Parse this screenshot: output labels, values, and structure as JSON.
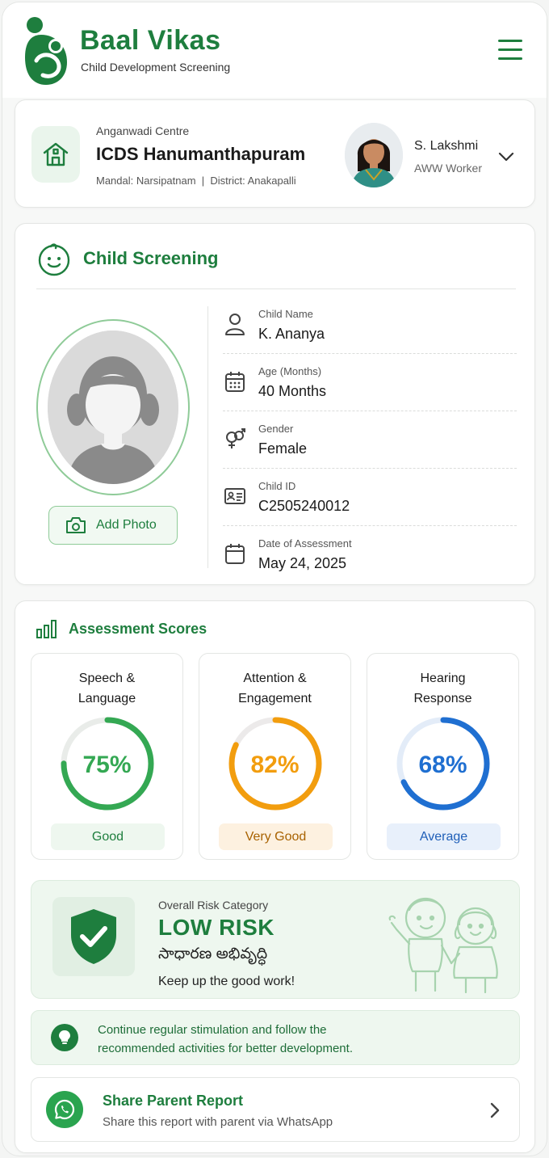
{
  "header": {
    "brand_title": "Baal Vikas",
    "brand_subtitle": "Child Development Screening",
    "logo_icon": "mother-child-logo-icon",
    "menu_icon": "hamburger-menu-icon"
  },
  "centre": {
    "label": "Anganwadi Centre",
    "name": "ICDS Hanumanthapuram",
    "location": "Mandal: Narsipatnam  |  District: Anakapalli",
    "icon": "anganwadi-house-icon",
    "worker": {
      "name": "S. Lakshmi",
      "role": "AWW Worker"
    }
  },
  "screening": {
    "title": "Child Screening",
    "add_photo_label": "Add Photo",
    "details": [
      {
        "label": "Child Name",
        "value": "K. Ananya",
        "icon": "person-icon"
      },
      {
        "label": "Age (Months)",
        "value": "40 Months",
        "icon": "calendar-grid-icon"
      },
      {
        "label": "Gender",
        "value": "Female",
        "icon": "gender-icon"
      },
      {
        "label": "Child ID",
        "value": "C2505240012",
        "icon": "id-card-icon"
      },
      {
        "label": "Date of Assessment",
        "value": "May 24, 2025",
        "icon": "calendar-icon"
      }
    ]
  },
  "scores": {
    "title": "Assessment Scores",
    "items": [
      {
        "line1": "Speech &",
        "line2": "Language",
        "value": 75,
        "pct_text": "75%",
        "rating": "Good",
        "color": "#34a853",
        "track": "#e9ece9",
        "badge_bg": "#eef7ef",
        "badge_fg": "#1e7e3e"
      },
      {
        "line1": "Attention &",
        "line2": "Engagement",
        "value": 82,
        "pct_text": "82%",
        "rating": "Very Good",
        "color": "#f29d0e",
        "track": "#eceaea",
        "badge_bg": "#fdf1e0",
        "badge_fg": "#a86200"
      },
      {
        "line1": "Hearing",
        "line2": "Response",
        "value": 68,
        "pct_text": "68%",
        "rating": "Average",
        "color": "#1f6fd1",
        "track": "#e3ecf8",
        "badge_bg": "#e8f0fb",
        "badge_fg": "#1f5fb8"
      }
    ]
  },
  "risk": {
    "label": "Overall Risk Category",
    "value": "LOW RISK",
    "value_telugu": "సాధారణ అభివృద్ధి",
    "message": "Keep up the good work!"
  },
  "tip": {
    "line1": "Continue regular stimulation and follow the",
    "line2": "recommended activities for better development."
  },
  "share": {
    "title": "Share Parent Report",
    "subtitle": "Share this report with parent via WhatsApp"
  },
  "colors": {
    "brand_green": "#1e7e3e",
    "light_green": "#eef7ef"
  }
}
